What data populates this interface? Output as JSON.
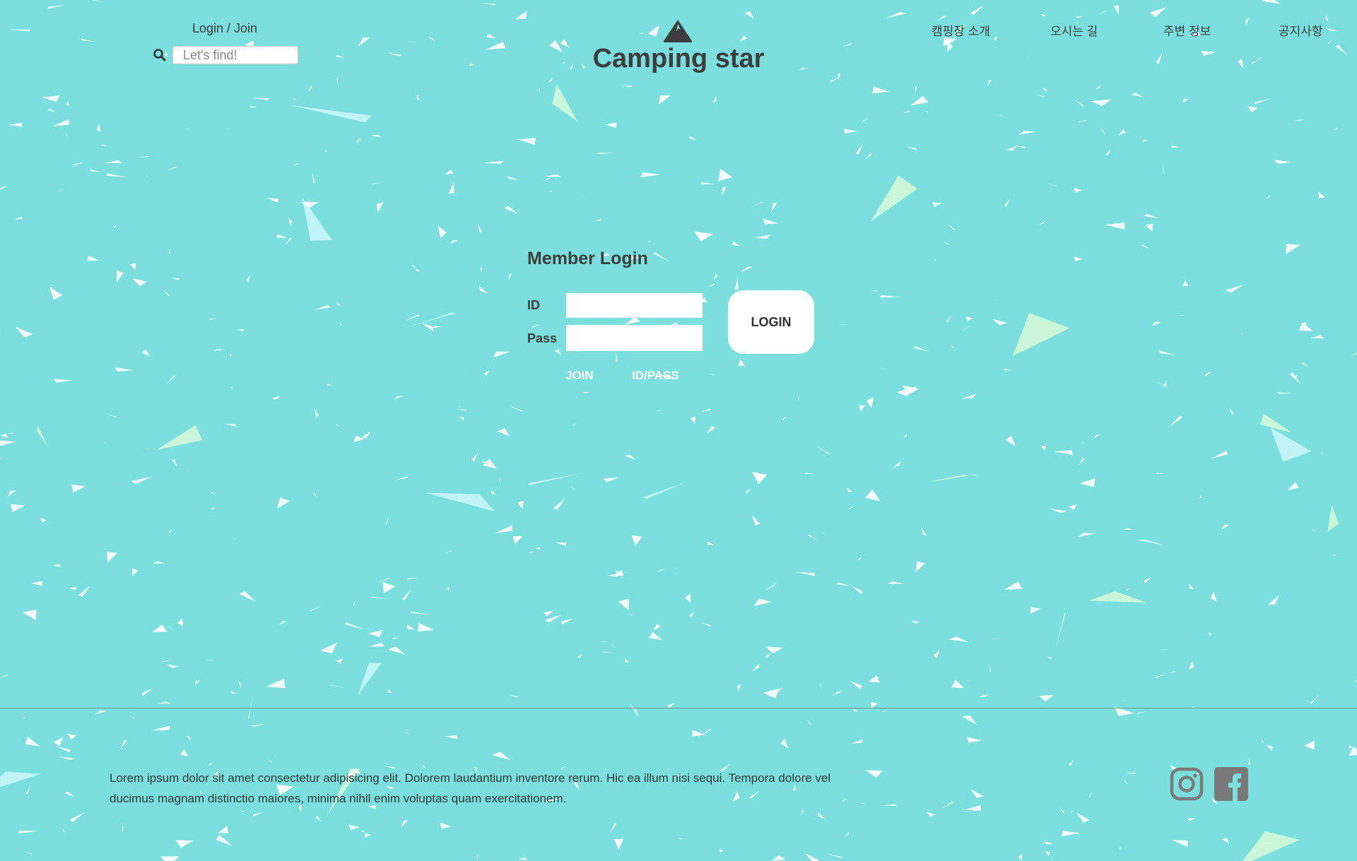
{
  "header": {
    "login_join": "Login / Join",
    "search_placeholder": "Let's find!",
    "logo_text": "Camping star",
    "nav": [
      "캠핑장 소개",
      "오시는 길",
      "주변 정보",
      "공지사항"
    ]
  },
  "login": {
    "title": "Member Login",
    "id_label": "ID",
    "pass_label": "Pass",
    "button_label": "LOGIN",
    "join_link": "JOIN",
    "find_link": "ID/PASS"
  },
  "footer": {
    "text": "Lorem ipsum dolor sit amet consectetur adipisicing elit. Dolorem laudantium inventore rerum. Hic ea illum nisi sequi. Tempora dolore vel ducimus magnam distinctio maiores, minima nihil enim voluptas quam exercitationem.",
    "social": [
      "instagram",
      "facebook"
    ]
  },
  "colors": {
    "background": "#7adfdd",
    "text": "#3d3d3d",
    "icon": "#7a7a7a"
  }
}
